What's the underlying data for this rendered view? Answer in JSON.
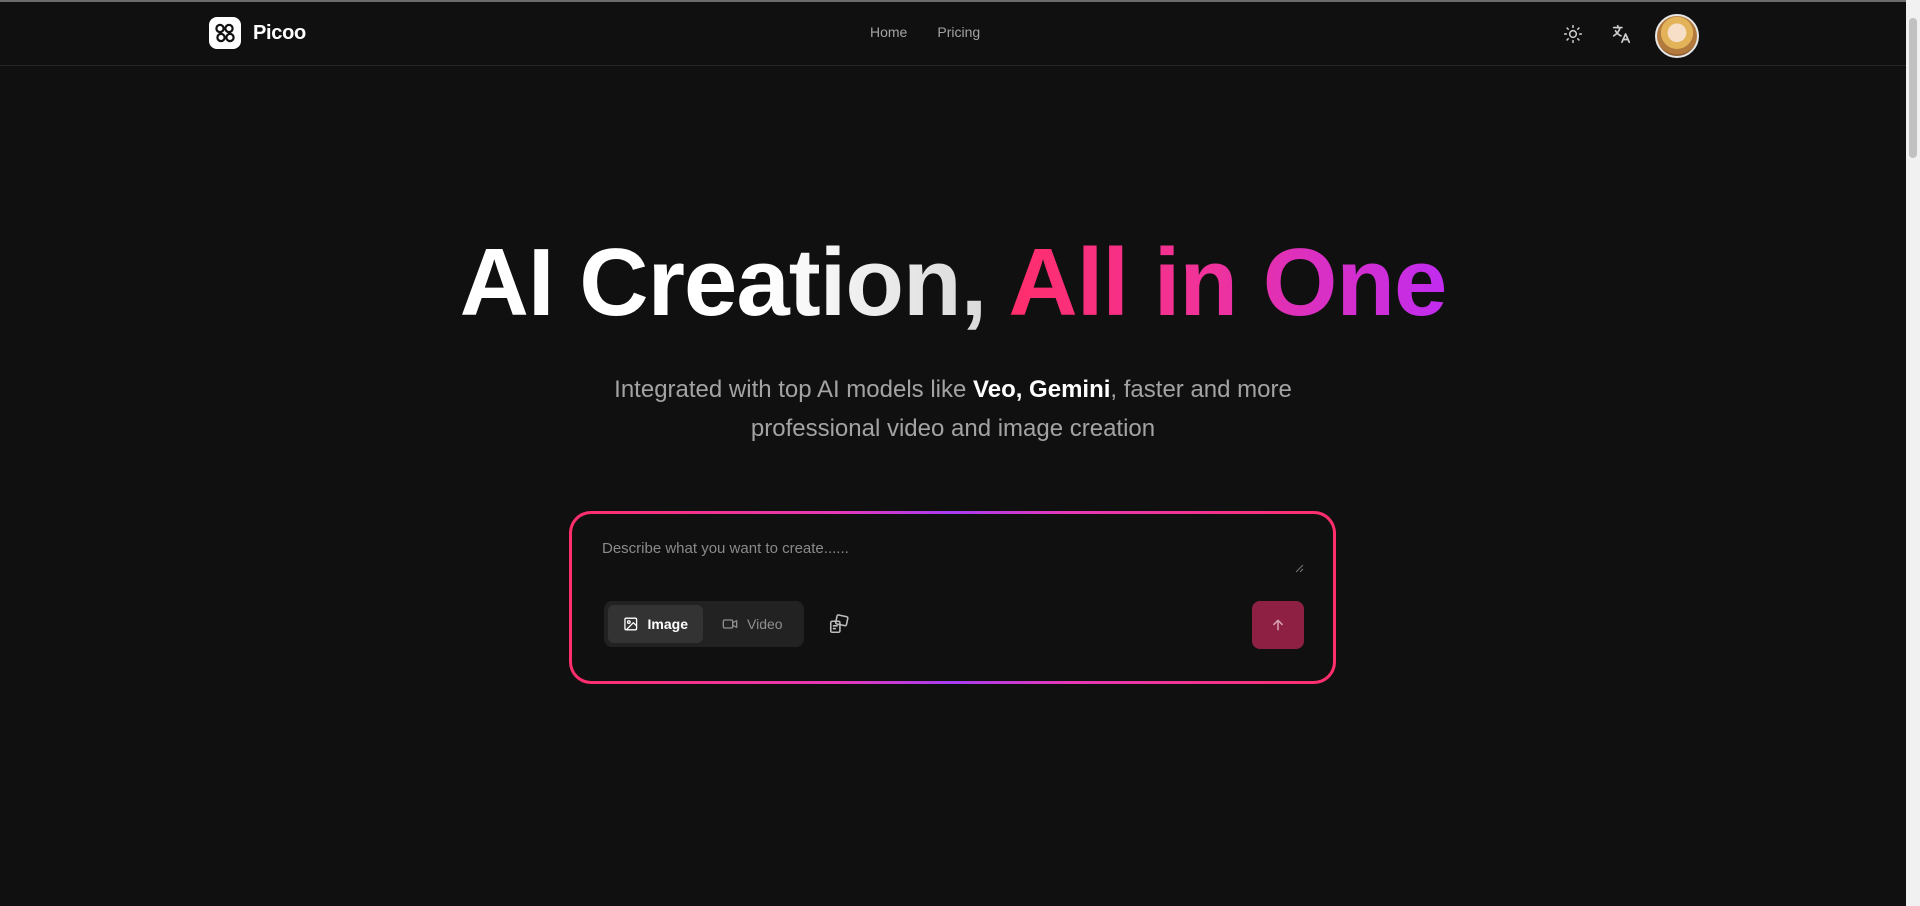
{
  "header": {
    "brand_name": "Picoo",
    "nav": [
      {
        "label": "Home"
      },
      {
        "label": "Pricing"
      }
    ],
    "icons": [
      "theme-toggle-icon",
      "translate-icon",
      "avatar"
    ]
  },
  "hero": {
    "title_part1": "AI Creation, ",
    "title_part2": "All in One",
    "subtitle_pre": "Integrated with top AI models like ",
    "subtitle_bold": "Veo, Gemini",
    "subtitle_post": ", faster and more professional video and image creation"
  },
  "prompt": {
    "placeholder": "Describe what you want to create......",
    "value": "",
    "modes": [
      {
        "label": "Image",
        "icon": "image-icon",
        "active": true
      },
      {
        "label": "Video",
        "icon": "video-icon",
        "active": false
      }
    ],
    "ratio_icon": "aspect-ratio-icon",
    "send_icon": "arrow-up-icon"
  },
  "colors": {
    "background": "#101010",
    "accent_pink": "#ff2e6b",
    "accent_purple": "#c02cf0",
    "send_button": "#8e2143"
  }
}
